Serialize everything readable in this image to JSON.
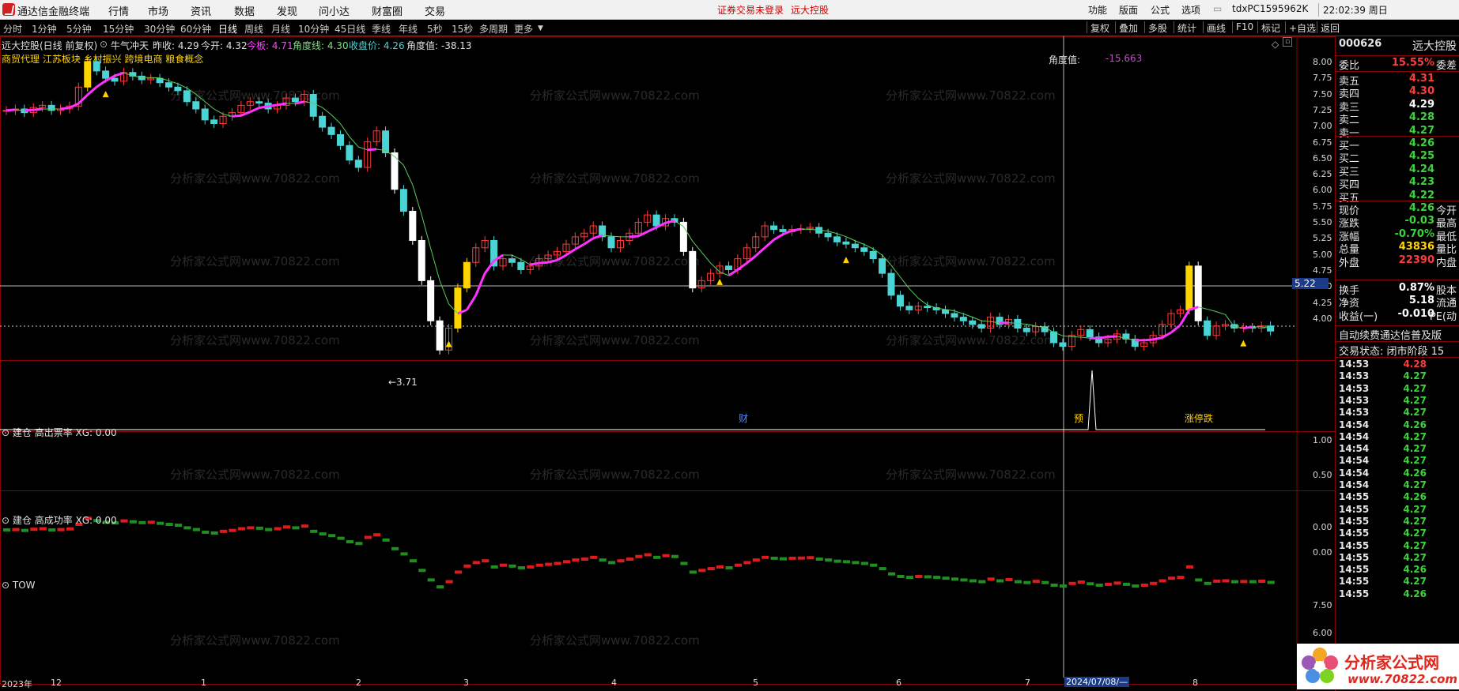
{
  "titlebar": {
    "app_name": "通达信金融终端",
    "menus": [
      "行情",
      "市场",
      "资讯",
      "数据",
      "发现",
      "问小达",
      "财富圈",
      "交易"
    ],
    "warning": "证券交易未登录",
    "broker": "远大控股",
    "right_menus": [
      "功能",
      "版面",
      "公式",
      "选项"
    ],
    "account": "tdxPC1595962K",
    "time": "22:02:39 周日"
  },
  "periods": [
    "分时",
    "1分钟",
    "5分钟",
    "15分钟",
    "30分钟",
    "60分钟",
    "日线",
    "周线",
    "月线",
    "10分钟",
    "45日线",
    "季线",
    "年线",
    "5秒",
    "15秒",
    "多周期",
    "更多"
  ],
  "selected_period": "日线",
  "toolbar": [
    "复权",
    "叠加",
    "多股",
    "统计",
    "画线",
    "F10",
    "标记",
    "+自选",
    "返回"
  ],
  "main_chart": {
    "stock_label": "远大控股(日线 前复权)",
    "indicator_name": "牛气冲天",
    "prev_close": "昨收: 4.29",
    "today_open": "今开: 4.32",
    "today_label": "今板: 4.71",
    "angle_line": "角度线: 4.30",
    "close_price": "收盘价: 4.26",
    "angle_value": "角度值: -38.13",
    "concepts": "商贸代理 江苏板块 乡村振兴 跨境电商 粮食概念",
    "crosshair_label": "角度值:",
    "crosshair_value": "-15.663",
    "min_label": "←3.71",
    "cursor_price": "5.22",
    "y_ticks": [
      "8.00",
      "7.75",
      "7.50",
      "7.25",
      "7.00",
      "6.75",
      "6.50",
      "6.25",
      "6.00",
      "5.75",
      "5.50",
      "5.25",
      "5.00",
      "4.75",
      "4.50",
      "4.25",
      "4.00"
    ],
    "event_markers": [
      "财",
      "预",
      "涨停跌"
    ]
  },
  "panel2": {
    "title": "建仓 高出票率 XG: 0.00",
    "y_ticks": [
      "1.00",
      "0.50"
    ]
  },
  "panel3": {
    "title": "建仓 高成功率 XG: 0.00",
    "y_ticks": [
      "0.00",
      "0.00"
    ]
  },
  "panel4": {
    "title": "TOW",
    "y_ticks": [
      "7.50",
      "6.00"
    ]
  },
  "x_axis": {
    "labels": [
      "2023年",
      "12",
      "1",
      "2",
      "3",
      "4",
      "5",
      "6",
      "7",
      "8"
    ],
    "cursor_date": "2024/07/08/—"
  },
  "watermark": "分析家公式网www.70822.com",
  "quote_panel": {
    "code": "000626",
    "name": "远大控股",
    "weibi_label": "委比",
    "weibi_value": "15.55%",
    "weicha_label": "委差",
    "sells": [
      {
        "label": "卖五",
        "price": "4.31",
        "color": "#ff3b3b"
      },
      {
        "label": "卖四",
        "price": "4.30",
        "color": "#ff3b3b"
      },
      {
        "label": "卖三",
        "price": "4.29",
        "color": "#ffffff"
      },
      {
        "label": "卖二",
        "price": "4.28",
        "color": "#3ad43a"
      },
      {
        "label": "卖一",
        "price": "4.27",
        "color": "#3ad43a"
      }
    ],
    "buys": [
      {
        "label": "买一",
        "price": "4.26",
        "color": "#3ad43a"
      },
      {
        "label": "买二",
        "price": "4.25",
        "color": "#3ad43a"
      },
      {
        "label": "买三",
        "price": "4.24",
        "color": "#3ad43a"
      },
      {
        "label": "买四",
        "price": "4.23",
        "color": "#3ad43a"
      },
      {
        "label": "买五",
        "price": "4.22",
        "color": "#3ad43a"
      }
    ],
    "stats": [
      {
        "l": "现价",
        "v": "4.26",
        "r": "今开",
        "color": "#3ad43a"
      },
      {
        "l": "涨跌",
        "v": "-0.03",
        "r": "最高",
        "color": "#3ad43a"
      },
      {
        "l": "涨幅",
        "v": "-0.70%",
        "r": "最低",
        "color": "#3ad43a"
      },
      {
        "l": "总量",
        "v": "43836",
        "r": "量比",
        "color": "#ffd400"
      },
      {
        "l": "外盘",
        "v": "22390",
        "r": "内盘",
        "color": "#ff3b3b"
      }
    ],
    "stats2": [
      {
        "l": "换手",
        "v": "0.87%",
        "r": "股本",
        "color": "#ffffff"
      },
      {
        "l": "净资",
        "v": "5.18",
        "r": "流通",
        "color": "#ffffff"
      },
      {
        "l": "收益(一)",
        "v": "-0.010",
        "r": "PE(动",
        "color": "#ffffff"
      }
    ],
    "notice": "自动续费通达信普及版",
    "status": "交易状态: 闭市阶段 15",
    "ticks": [
      {
        "t": "14:53",
        "p": "4.28"
      },
      {
        "t": "14:53",
        "p": "4.27"
      },
      {
        "t": "14:53",
        "p": "4.27"
      },
      {
        "t": "14:53",
        "p": "4.27"
      },
      {
        "t": "14:53",
        "p": "4.27"
      },
      {
        "t": "14:54",
        "p": "4.26"
      },
      {
        "t": "14:54",
        "p": "4.27"
      },
      {
        "t": "14:54",
        "p": "4.27"
      },
      {
        "t": "14:54",
        "p": "4.27"
      },
      {
        "t": "14:54",
        "p": "4.26"
      },
      {
        "t": "14:54",
        "p": "4.27"
      },
      {
        "t": "14:55",
        "p": "4.26"
      },
      {
        "t": "14:55",
        "p": "4.27"
      },
      {
        "t": "14:55",
        "p": "4.27"
      },
      {
        "t": "14:55",
        "p": "4.27"
      },
      {
        "t": "14:55",
        "p": "4.27"
      },
      {
        "t": "14:55",
        "p": "4.27"
      },
      {
        "t": "14:55",
        "p": "4.26"
      },
      {
        "t": "14:55",
        "p": "4.27"
      },
      {
        "t": "14:55",
        "p": "4.26"
      }
    ]
  },
  "logo": {
    "text": "分析家公式网",
    "url_text": "www.70822.com"
  },
  "chart_data": {
    "type": "candlestick",
    "ylim": [
      3.7,
      8.1
    ],
    "closes": [
      7.28,
      7.3,
      7.25,
      7.32,
      7.35,
      7.28,
      7.3,
      7.34,
      7.6,
      7.95,
      7.82,
      7.72,
      7.68,
      7.8,
      7.75,
      7.7,
      7.72,
      7.66,
      7.6,
      7.55,
      7.4,
      7.3,
      7.15,
      7.1,
      7.2,
      7.25,
      7.35,
      7.4,
      7.38,
      7.3,
      7.35,
      7.45,
      7.4,
      7.5,
      7.2,
      7.05,
      6.95,
      6.8,
      6.6,
      6.5,
      6.85,
      7.0,
      6.7,
      6.2,
      5.9,
      5.5,
      4.95,
      4.4,
      4.0,
      4.3,
      4.85,
      5.2,
      5.4,
      5.5,
      5.15,
      5.25,
      5.2,
      5.1,
      5.15,
      5.25,
      5.3,
      5.35,
      5.45,
      5.55,
      5.6,
      5.7,
      5.55,
      5.4,
      5.5,
      5.6,
      5.75,
      5.85,
      5.7,
      5.8,
      5.75,
      5.35,
      4.85,
      4.95,
      5.05,
      5.15,
      5.1,
      5.25,
      5.4,
      5.55,
      5.7,
      5.65,
      5.62,
      5.65,
      5.66,
      5.68,
      5.6,
      5.55,
      5.48,
      5.45,
      5.4,
      5.35,
      5.25,
      5.05,
      4.75,
      4.6,
      4.55,
      4.6,
      4.58,
      4.55,
      4.5,
      4.45,
      4.4,
      4.35,
      4.3,
      4.45,
      4.35,
      4.42,
      4.3,
      4.25,
      4.32,
      4.25,
      4.1,
      4.05,
      4.2,
      4.28,
      4.18,
      4.1,
      4.15,
      4.22,
      4.15,
      4.05,
      4.1,
      4.2,
      4.35,
      4.5,
      4.55,
      5.15,
      4.4,
      4.2,
      4.33,
      4.35,
      4.3,
      4.31,
      4.3,
      4.33,
      4.26
    ]
  }
}
